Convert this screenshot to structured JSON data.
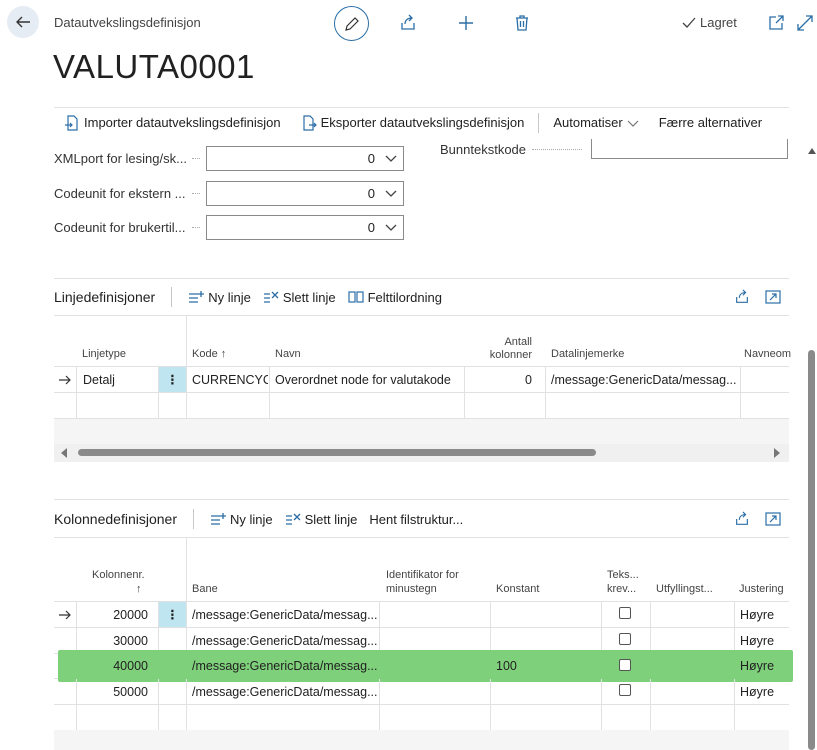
{
  "header": {
    "breadcrumb": "Datautvekslingsdefinisjon",
    "title": "VALUTA0001",
    "saved_label": "Lagret"
  },
  "actions": {
    "import_label": "Importer datautvekslingsdefinisjon",
    "export_label": "Eksporter datautvekslingsdefinisjon",
    "automate_label": "Automatiser",
    "fewer_label": "Færre alternativer"
  },
  "fields": [
    {
      "label": "XMLport for lesing/sk...",
      "value": "0"
    },
    {
      "label": "Codeunit for ekstern ...",
      "value": "0"
    },
    {
      "label": "Codeunit for brukertil...",
      "value": "0"
    }
  ],
  "footer_field": {
    "label": "Bunntekstkode",
    "value": ""
  },
  "line_defs": {
    "title": "Linjedefinisjoner",
    "new_line": "Ny linje",
    "delete_line": "Slett linje",
    "field_mapping": "Felttilordning",
    "headers": {
      "line_type": "Linjetype",
      "code": "Kode",
      "name": "Navn",
      "col_count_1": "Antall",
      "col_count_2": "kolonner",
      "data_line_tag": "Datalinjemerke",
      "namespace": "Navneom"
    },
    "rows": [
      {
        "line_type": "Detalj",
        "code": "CURRENCYCH...",
        "name": "Overordnet node for valutakode",
        "col_count": "0",
        "data_line_tag": "/message:GenericData/messag..."
      }
    ]
  },
  "col_defs": {
    "title": "Kolonnedefinisjoner",
    "new_line": "Ny linje",
    "delete_line": "Slett linje",
    "get_structure": "Hent filstruktur...",
    "headers": {
      "col_no": "Kolonnenr.",
      "path": "Bane",
      "minus_id_1": "Identifikator for",
      "minus_id_2": "minustegn",
      "constant": "Konstant",
      "text_req_1": "Teks...",
      "text_req_2": "krev...",
      "padding": "Utfyllingst...",
      "justify": "Justering"
    },
    "rows": [
      {
        "col_no": "20000",
        "path": "/message:GenericData/messag...",
        "constant": "",
        "justify": "Høyre"
      },
      {
        "col_no": "30000",
        "path": "/message:GenericData/messag...",
        "constant": "",
        "justify": "Høyre"
      },
      {
        "col_no": "40000",
        "path": "/message:GenericData/messag...",
        "constant": "100",
        "justify": "Høyre"
      },
      {
        "col_no": "50000",
        "path": "/message:GenericData/messag...",
        "constant": "",
        "justify": "Høyre"
      }
    ]
  },
  "colors": {
    "accent": "#2b6ea6",
    "highlight": "#7fd07b",
    "selected_cell": "#bfe6f0"
  }
}
